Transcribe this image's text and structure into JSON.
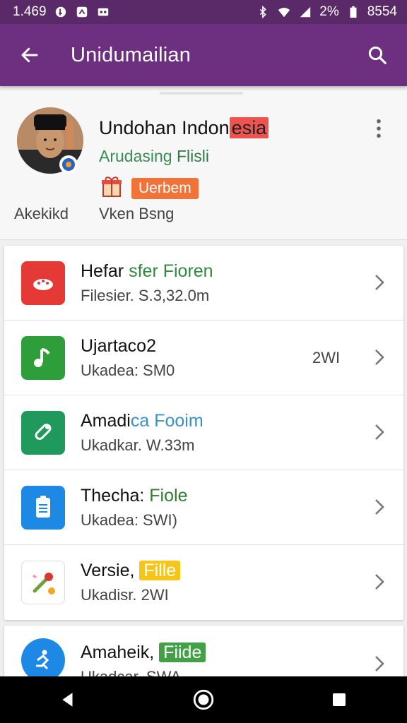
{
  "status_bar": {
    "time": "1.469",
    "battery_text": "2%",
    "extra": "8554"
  },
  "app_bar": {
    "title": "Unidumailian",
    "back_icon": "arrow-back-icon",
    "search_icon": "search-icon"
  },
  "profile": {
    "name_main": "Undohan Indon",
    "name_highlight": "esia",
    "subtitle_a": "Arudasing ",
    "subtitle_b": "Flisli",
    "badge": "Uerbem",
    "footer_left": "Akekikd",
    "footer_mid": "Vken Bsng"
  },
  "list": [
    {
      "title_a": "Hefar ",
      "title_b": "sfer Fioren",
      "sub": "Filesier. S.3,32.0m",
      "meta": "",
      "icon_color": "#e53935"
    },
    {
      "title_a": "Ujartaco2",
      "title_b": "",
      "sub": "Ukadea: SM0",
      "meta": "2WI",
      "icon_color": "#2e9e3a"
    },
    {
      "title_a": "Amadi",
      "title_b": "ca Fooim",
      "sub": "Ukadkar. W.33m",
      "meta": "",
      "icon_color": "#1f9a5c"
    },
    {
      "title_a": "Thecha: ",
      "title_b": "Fiole",
      "sub": "Ukadea: SWI)",
      "meta": "",
      "icon_color": "#1e88e5"
    },
    {
      "title_a": "Versie, ",
      "title_b": "Fille",
      "sub": "Ukadisr. 2WI",
      "meta": "",
      "icon_color": "#ffffff"
    },
    {
      "title_a": "Amaheik, ",
      "title_b": "Fiide",
      "sub": "Ukadcar. SWA",
      "meta": "",
      "icon_color": "#1e88e5"
    }
  ]
}
